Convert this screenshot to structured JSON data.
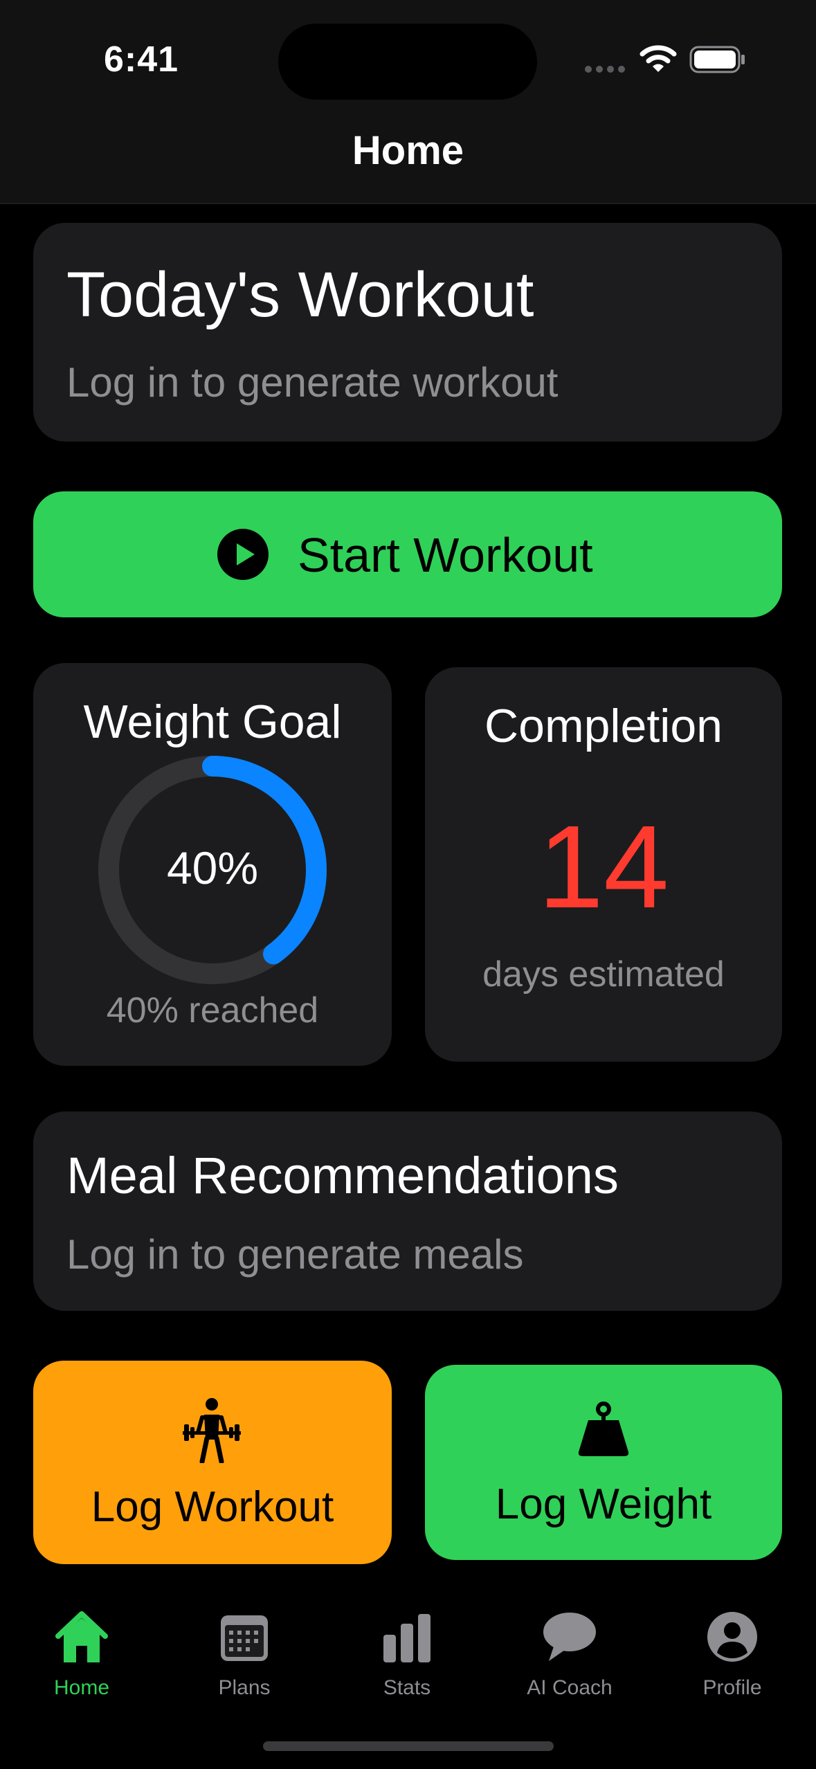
{
  "status_bar": {
    "time": "6:41",
    "icons": [
      "signal-icon",
      "wifi-icon",
      "battery-icon"
    ]
  },
  "nav": {
    "title": "Home"
  },
  "todays_workout": {
    "title": "Today's Workout",
    "subtitle": "Log in to generate workout"
  },
  "start_workout": {
    "label": "Start Workout",
    "icon": "play-circle-icon"
  },
  "weight_goal": {
    "title": "Weight Goal",
    "progress_fraction": 0.4,
    "progress_label": "40%",
    "caption": "40% reached"
  },
  "completion": {
    "title": "Completion",
    "value": "14",
    "caption": "days estimated"
  },
  "meal_recommendations": {
    "title": "Meal Recommendations",
    "subtitle": "Log in to generate meals"
  },
  "actions": {
    "log_workout": {
      "label": "Log Workout",
      "icon": "weightlifter-icon"
    },
    "log_weight": {
      "label": "Log Weight",
      "icon": "kettlebell-icon"
    }
  },
  "tab_bar": {
    "items": [
      {
        "label": "Home",
        "icon": "house-icon",
        "active": true
      },
      {
        "label": "Plans",
        "icon": "calendar-icon",
        "active": false
      },
      {
        "label": "Stats",
        "icon": "bar-chart-icon",
        "active": false
      },
      {
        "label": "AI Coach",
        "icon": "chat-bubble-icon",
        "active": false
      },
      {
        "label": "Profile",
        "icon": "person-circle-icon",
        "active": false
      }
    ]
  },
  "colors": {
    "accent_green": "#30d158",
    "accent_orange": "#ff9f0a",
    "accent_blue": "#0a84ff",
    "accent_red": "#ff3b30",
    "card_bg": "#1c1c1e",
    "secondary_text": "#8e8e93"
  }
}
